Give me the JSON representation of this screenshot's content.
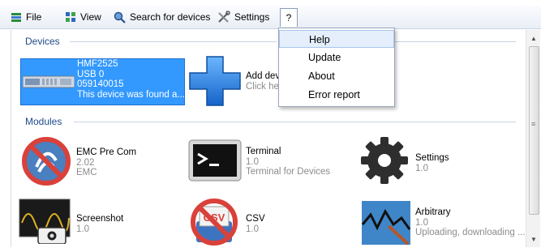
{
  "menu": {
    "file_label": "File",
    "view_label": "View",
    "search_label": "Search for devices",
    "settings_label": "Settings",
    "help_label": "?"
  },
  "dropdown": {
    "items": [
      "Help",
      "Update",
      "About",
      "Error report"
    ],
    "highlighted": "Help"
  },
  "devices": {
    "title": "Devices",
    "device": {
      "name": "HMF2525",
      "port": "USB 0",
      "serial": "059140015",
      "note": "This device was found a..."
    },
    "add": {
      "title": "Add dev",
      "subtitle": "Click he"
    }
  },
  "modules": {
    "title": "Modules",
    "items": [
      {
        "name": "EMC Pre Com",
        "version": "2.02",
        "desc": "EMC",
        "icon": "emc-prohibited-icon"
      },
      {
        "name": "Terminal",
        "version": "1.0",
        "desc": "Terminal for Devices",
        "icon": "terminal-icon"
      },
      {
        "name": "Settings",
        "version": "1.0",
        "desc": "",
        "icon": "gear-icon"
      },
      {
        "name": "Screenshot",
        "version": "1.0",
        "desc": "",
        "icon": "screenshot-icon"
      },
      {
        "name": "CSV",
        "version": "1.0",
        "desc": "",
        "icon": "csv-prohibited-icon"
      },
      {
        "name": "Arbitrary",
        "version": "1.0",
        "desc": "Uploading, downloading ...",
        "icon": "arbitrary-waveform-icon"
      }
    ]
  },
  "colors": {
    "selection": "#3399ff",
    "section_title": "#1e4a8a",
    "menu_highlight": "#e5effb"
  }
}
